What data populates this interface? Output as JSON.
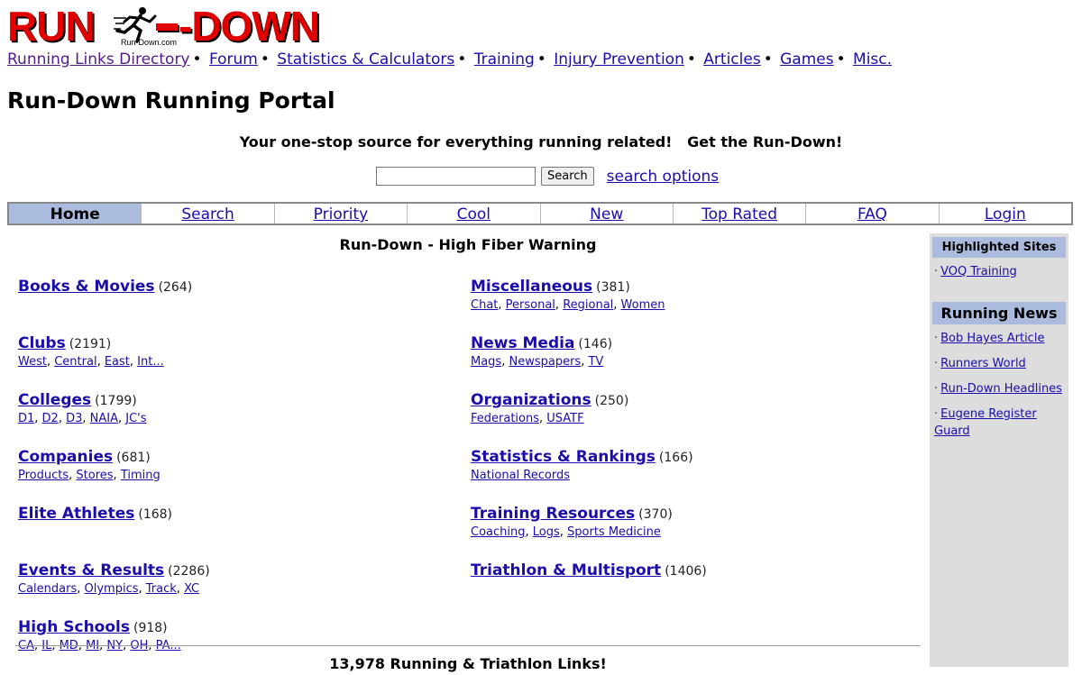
{
  "logo": {
    "left_word": "RUN",
    "right_word": "-DOWN",
    "domain": "Run-Down.com",
    "color": "#e00000"
  },
  "topnav": {
    "items": [
      "Running Links Directory",
      "Forum",
      "Statistics & Calculators",
      "Training",
      "Injury Prevention",
      "Articles",
      "Games",
      "Misc."
    ],
    "separator": "•"
  },
  "page_title": "Run-Down Running Portal",
  "tagline": "Your one-stop source for everything running related!   Get the Run-Down!",
  "search": {
    "value": "",
    "placeholder": "",
    "button_label": "Search",
    "options_label": "search options"
  },
  "tabs": [
    "Home",
    "Search",
    "Priority",
    "Cool",
    "New",
    "Top Rated",
    "FAQ",
    "Login"
  ],
  "main": {
    "heading": "Run-Down - High Fiber Warning",
    "left_categories": [
      {
        "title": "Books & Movies",
        "count": "(264)",
        "subs": []
      },
      {
        "title": "Clubs",
        "count": "(2191)",
        "subs": [
          "West",
          "Central",
          "East",
          "Int..."
        ]
      },
      {
        "title": "Colleges",
        "count": "(1799)",
        "subs": [
          "D1",
          "D2",
          "D3",
          "NAIA",
          "JC's"
        ]
      },
      {
        "title": "Companies",
        "count": "(681)",
        "subs": [
          "Products",
          "Stores",
          "Timing"
        ]
      },
      {
        "title": "Elite Athletes",
        "count": "(168)",
        "subs": []
      },
      {
        "title": "Events & Results",
        "count": "(2286)",
        "subs": [
          "Calendars",
          "Olympics",
          "Track",
          "XC"
        ]
      },
      {
        "title": "High Schools",
        "count": "(918)",
        "subs": [
          "CA",
          "IL",
          "MD",
          "MI",
          "NY",
          "OH",
          "PA..."
        ]
      }
    ],
    "right_categories": [
      {
        "title": "Miscellaneous",
        "count": "(381)",
        "subs": [
          "Chat",
          "Personal",
          "Regional",
          "Women"
        ]
      },
      {
        "title": "News Media",
        "count": "(146)",
        "subs": [
          "Mags",
          "Newspapers",
          "TV"
        ]
      },
      {
        "title": "Organizations",
        "count": "(250)",
        "subs": [
          "Federations",
          "USATF"
        ]
      },
      {
        "title": "Statistics & Rankings",
        "count": "(166)",
        "subs": [
          "National Records"
        ]
      },
      {
        "title": "Training Resources",
        "count": "(370)",
        "subs": [
          "Coaching",
          "Logs",
          "Sports Medicine"
        ]
      },
      {
        "title": "Triathlon & Multisport",
        "count": "(1406)",
        "subs": []
      }
    ],
    "footer_count": "13,978 Running & Triathlon Links!"
  },
  "sidebar": {
    "highlighted_heading": "Highlighted Sites",
    "highlighted_items": [
      "VOQ Training"
    ],
    "news_heading": "Running News",
    "news_items": [
      "Bob Hayes Article",
      "Runners World",
      "Run-Down Headlines",
      "Eugene Register Guard"
    ],
    "bullet": "·"
  },
  "colors": {
    "link": "#1a0dab",
    "visited_link": "#551a8b",
    "tab_active_bg": "#aabbdd",
    "sidebar_bg": "#dddddd"
  }
}
